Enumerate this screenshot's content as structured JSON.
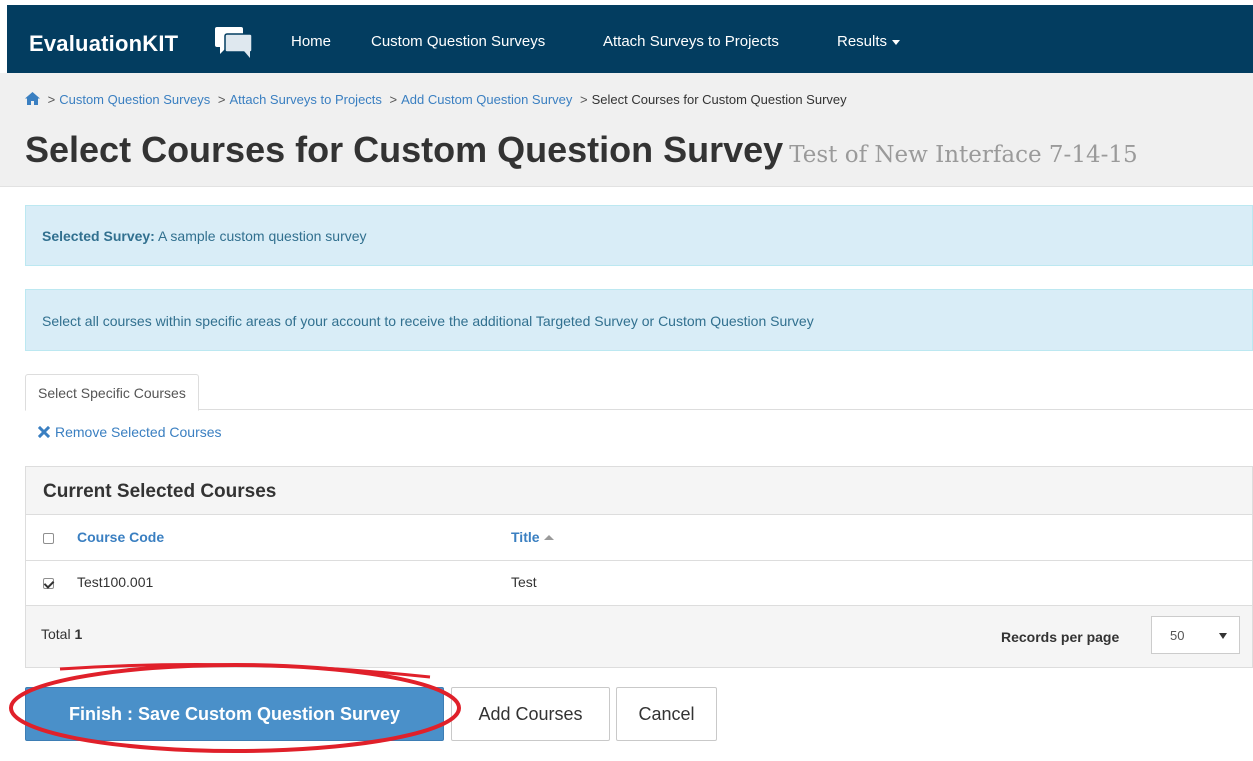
{
  "navbar": {
    "brand": "EvaluationKIT",
    "links": [
      {
        "label": "Home"
      },
      {
        "label": "Custom Question Surveys"
      },
      {
        "label": "Attach Surveys to Projects"
      },
      {
        "label": "Results"
      }
    ],
    "brand_icon": "speech-bubbles-icon"
  },
  "breadcrumb": {
    "home_icon": "home-icon",
    "separator": ">",
    "items": [
      {
        "label": "Custom Question Surveys"
      },
      {
        "label": "Attach Surveys to Projects"
      },
      {
        "label": "Add Custom Question Survey"
      }
    ],
    "current": "Select Courses for Custom Question Survey"
  },
  "page": {
    "title": "Select Courses for Custom Question Survey",
    "subtitle": "Test of New Interface 7-14-15"
  },
  "alerts": {
    "selected_label": "Selected Survey:",
    "selected_value": "A sample custom question survey",
    "info": "Select all courses within specific areas of your account to receive the additional Targeted Survey or Custom Question Survey"
  },
  "tabs": [
    {
      "label": "Select Specific Courses",
      "active": true
    }
  ],
  "actions": {
    "remove_selected": "Remove Selected Courses",
    "remove_icon": "x-icon"
  },
  "panel": {
    "title": "Current Selected Courses",
    "columns": [
      {
        "label": "Course Code"
      },
      {
        "label": "Title",
        "sort": "ascending"
      }
    ],
    "rows": [
      {
        "checked": true,
        "course_code": "Test100.001",
        "title": "Test"
      }
    ],
    "footer": {
      "total_label": "Total",
      "total_value": "1",
      "records_per_page_label": "Records per page",
      "records_per_page_value": "50"
    }
  },
  "buttons": {
    "finish": "Finish : Save Custom Question Survey",
    "add_courses": "Add Courses",
    "cancel": "Cancel"
  },
  "colors": {
    "navbar": "#033d60",
    "link": "#3a7fc1",
    "primary_button": "#4a90c9",
    "alert_bg": "#d9edf7",
    "highlight_ring": "#e0202a"
  }
}
